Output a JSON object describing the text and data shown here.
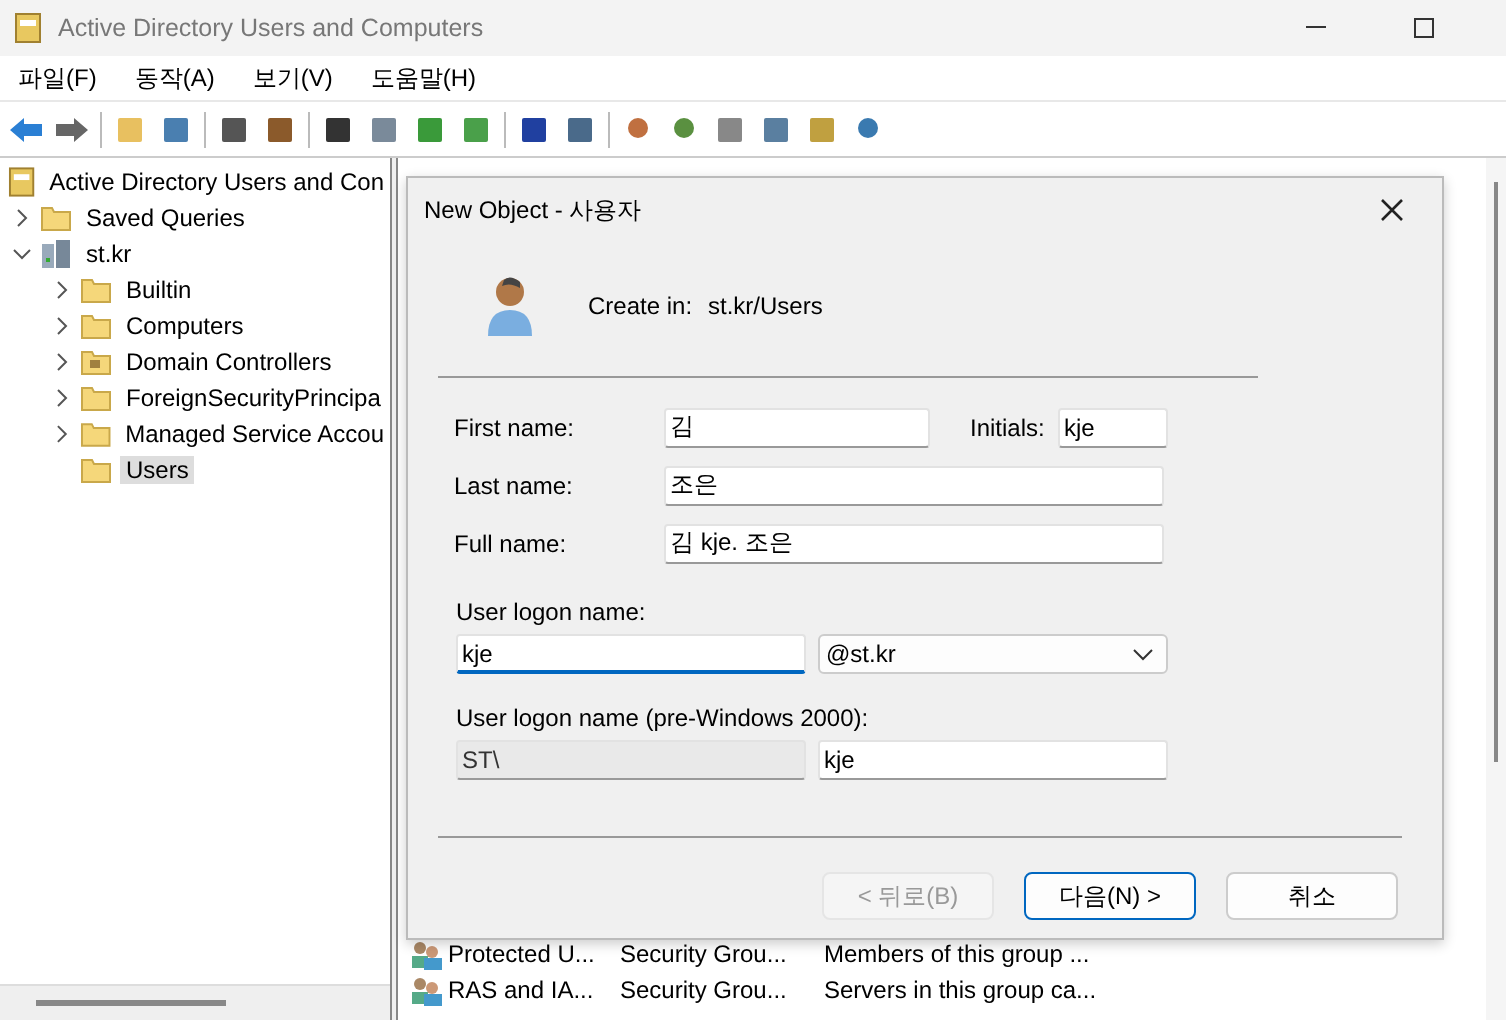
{
  "window": {
    "title": "Active Directory Users and Computers"
  },
  "menu": [
    {
      "label": "파일(F)"
    },
    {
      "label": "동작(A)"
    },
    {
      "label": "보기(V)"
    },
    {
      "label": "도움말(H)"
    }
  ],
  "tree": {
    "label": "Active Directory Users and Con",
    "children": [
      {
        "label": "Saved Queries",
        "kind": "folder",
        "expanded": false,
        "selected": false
      },
      {
        "label": "st.kr",
        "kind": "domain",
        "expanded": true,
        "selected": false,
        "children": [
          {
            "label": "Builtin",
            "kind": "folder",
            "expandable": true,
            "selected": false
          },
          {
            "label": "Computers",
            "kind": "folder",
            "expandable": true,
            "selected": false
          },
          {
            "label": "Domain Controllers",
            "kind": "ou",
            "expandable": true,
            "selected": false
          },
          {
            "label": "ForeignSecurityPrincipa",
            "kind": "folder",
            "expandable": true,
            "selected": false
          },
          {
            "label": "Managed Service Accou",
            "kind": "folder",
            "expandable": true,
            "selected": false
          },
          {
            "label": "Users",
            "kind": "folder",
            "expandable": false,
            "selected": true
          }
        ]
      }
    ]
  },
  "list": {
    "rows": [
      {
        "name": "Protected U...",
        "type": "Security Grou...",
        "description": "Members of this group ..."
      },
      {
        "name": "RAS and IA...",
        "type": "Security Grou...",
        "description": "Servers in this group ca..."
      }
    ]
  },
  "dialog": {
    "title": "New Object - 사용자",
    "create_in_label": "Create in:",
    "create_in": "st.kr/Users",
    "first_name": {
      "label": "First name:",
      "value": "김"
    },
    "initials": {
      "label": "Initials:",
      "value": "kje"
    },
    "last_name": {
      "label": "Last name:",
      "value": "조은"
    },
    "full_name": {
      "label": "Full name:",
      "value": "김 kje. 조은"
    },
    "logon": {
      "label": "User logon name:",
      "value": "kje",
      "focused": true,
      "domain": "@st.kr"
    },
    "pre2000": {
      "label": "User logon name (pre-Windows 2000):",
      "prefix": "ST\\",
      "value": "kje"
    },
    "buttons": [
      {
        "label": "< 뒤로(B)",
        "disabled": true,
        "default": false
      },
      {
        "label": "다음(N) >",
        "disabled": false,
        "default": true
      },
      {
        "label": "취소",
        "disabled": false,
        "default": false
      }
    ]
  }
}
